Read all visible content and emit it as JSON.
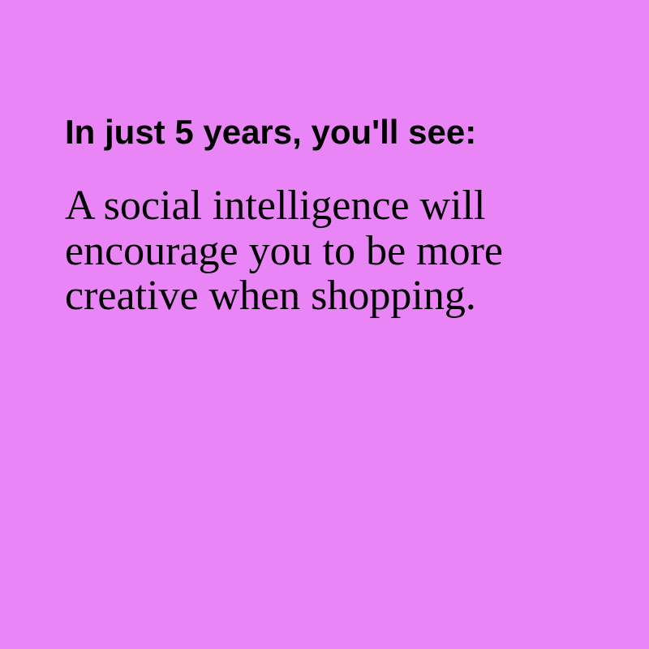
{
  "colors": {
    "background": "#e985f6",
    "text": "#000000"
  },
  "card": {
    "headline": "In just 5 years, you'll see:",
    "body": "A social intelligence will encourage you to be more creative when shopping."
  }
}
